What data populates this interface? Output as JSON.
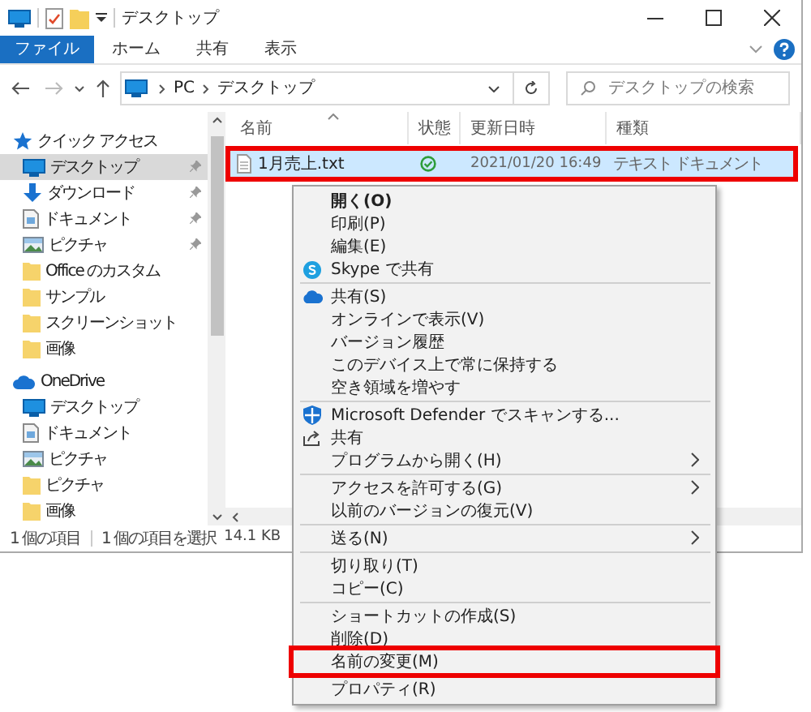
{
  "window": {
    "title": "デスクトップ"
  },
  "ribbon_tabs": [
    {
      "label": "ファイル",
      "selected": true
    },
    {
      "label": "ホーム",
      "selected": false
    },
    {
      "label": "共有",
      "selected": false
    },
    {
      "label": "表示",
      "selected": false
    }
  ],
  "address": {
    "path": [
      "PC",
      "デスクトップ"
    ]
  },
  "search": {
    "placeholder": "デスクトップの検索"
  },
  "nav": [
    {
      "label": "クイック アクセス",
      "kind": "star",
      "selected": false,
      "children": [
        {
          "label": "デスクトップ",
          "kind": "pc",
          "selected": true,
          "pinned": true
        },
        {
          "label": "ダウンロード",
          "kind": "download",
          "selected": false,
          "pinned": true
        },
        {
          "label": "ドキュメント",
          "kind": "document",
          "selected": false,
          "pinned": true
        },
        {
          "label": "ピクチャ",
          "kind": "picture",
          "selected": false,
          "pinned": true
        },
        {
          "label": "Office のカスタム",
          "kind": "folder",
          "selected": false,
          "pinned": false
        },
        {
          "label": "サンプル",
          "kind": "folder",
          "selected": false,
          "pinned": false
        },
        {
          "label": "スクリーンショット",
          "kind": "folder",
          "selected": false,
          "pinned": false
        },
        {
          "label": "画像",
          "kind": "folder",
          "selected": false,
          "pinned": false
        }
      ]
    },
    {
      "label": "OneDrive",
      "kind": "cloud",
      "selected": false,
      "children": [
        {
          "label": "デスクトップ",
          "kind": "pc",
          "selected": false,
          "pinned": false
        },
        {
          "label": "ドキュメント",
          "kind": "document",
          "selected": false,
          "pinned": false
        },
        {
          "label": "ピクチャ",
          "kind": "picture",
          "selected": false,
          "pinned": false
        },
        {
          "label": "ピクチャ",
          "kind": "folder",
          "selected": false,
          "pinned": false
        },
        {
          "label": "画像",
          "kind": "folder",
          "selected": false,
          "pinned": false
        }
      ]
    }
  ],
  "columns": [
    "名前",
    "状態",
    "更新日時",
    "種類"
  ],
  "files": [
    {
      "name": "1月売上.txt",
      "synced": true,
      "modified": "2021/01/20 16:49",
      "type": "テキスト ドキュメント",
      "selected": true,
      "highlighted": true
    }
  ],
  "status_bar": {
    "count": "1 個の項目",
    "selection": "1 個の項目を選択",
    "size": "14.1 KB"
  },
  "context_menu": [
    {
      "kind": "item",
      "label": "開く(O)",
      "bold": true
    },
    {
      "kind": "item",
      "label": "印刷(P)"
    },
    {
      "kind": "item",
      "label": "編集(E)"
    },
    {
      "kind": "skype",
      "label": "Skype で共有"
    },
    {
      "kind": "separator"
    },
    {
      "kind": "cloud",
      "label": "共有(S)"
    },
    {
      "kind": "item",
      "label": "オンラインで表示(V)"
    },
    {
      "kind": "item",
      "label": "バージョン履歴"
    },
    {
      "kind": "item",
      "label": "このデバイス上で常に保持する"
    },
    {
      "kind": "item",
      "label": "空き領域を増やす"
    },
    {
      "kind": "separator"
    },
    {
      "kind": "shield",
      "label": "Microsoft Defender でスキャンする..."
    },
    {
      "kind": "share",
      "label": "共有"
    },
    {
      "kind": "item",
      "label": "プログラムから開く(H)",
      "submenu": true
    },
    {
      "kind": "separator"
    },
    {
      "kind": "item",
      "label": "アクセスを許可する(G)",
      "submenu": true
    },
    {
      "kind": "item",
      "label": "以前のバージョンの復元(V)"
    },
    {
      "kind": "separator"
    },
    {
      "kind": "item",
      "label": "送る(N)",
      "submenu": true
    },
    {
      "kind": "separator"
    },
    {
      "kind": "item",
      "label": "切り取り(T)"
    },
    {
      "kind": "item",
      "label": "コピー(C)"
    },
    {
      "kind": "separator"
    },
    {
      "kind": "item",
      "label": "ショートカットの作成(S)"
    },
    {
      "kind": "item",
      "label": "削除(D)"
    },
    {
      "kind": "item",
      "label": "名前の変更(M)",
      "highlighted": true
    },
    {
      "kind": "separator"
    },
    {
      "kind": "item",
      "label": "プロパティ(R)"
    }
  ]
}
